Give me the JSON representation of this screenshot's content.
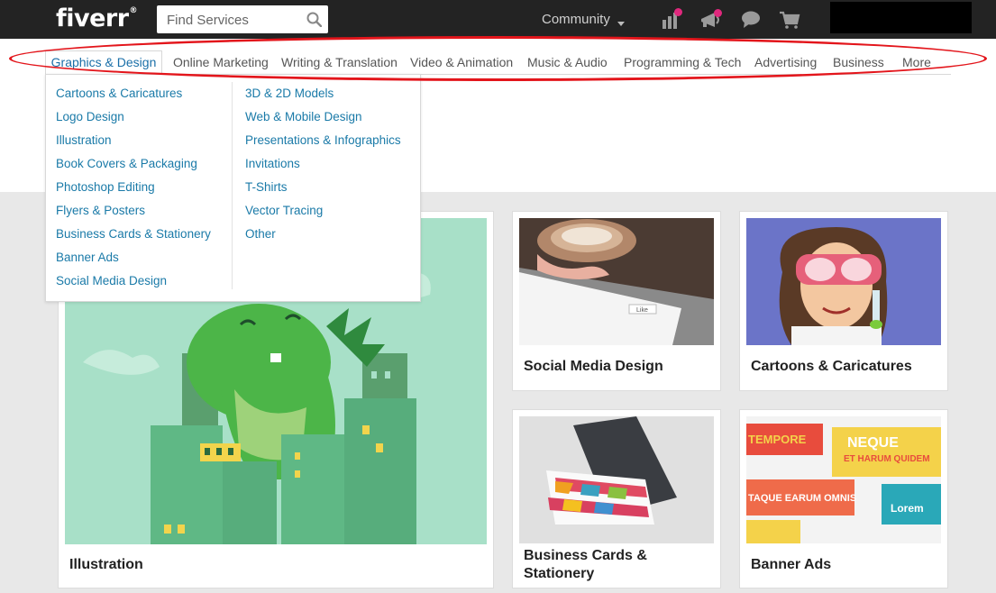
{
  "header": {
    "logo": "fiverr",
    "logo_mark": "®",
    "search_placeholder": "Find Services",
    "community_label": "Community",
    "icons": [
      "analytics-icon",
      "notifications-megaphone-icon",
      "messages-icon",
      "cart-icon"
    ],
    "notification_dot_color": "#e0287d",
    "bar_color": "#232323"
  },
  "nav": {
    "categories": [
      "Graphics & Design",
      "Online Marketing",
      "Writing & Translation",
      "Video & Animation",
      "Music & Audio",
      "Programming & Tech",
      "Advertising",
      "Business",
      "More"
    ],
    "active_color": "#1a6fa8"
  },
  "dropdown": {
    "col1": [
      "Cartoons & Caricatures",
      "Logo Design",
      "Illustration",
      "Book Covers & Packaging",
      "Photoshop Editing",
      "Flyers & Posters",
      "Business Cards & Stationery",
      "Banner Ads",
      "Social Media Design"
    ],
    "col2": [
      "3D & 2D Models",
      "Web & Mobile Design",
      "Presentations & Infographics",
      "Invitations",
      "T-Shirts",
      "Vector Tracing",
      "Other"
    ],
    "link_color": "#1a7aa8"
  },
  "cards": {
    "illustration": "Illustration",
    "social_media": "Social Media Design",
    "cartoons": "Cartoons & Caricatures",
    "business_cards": "Business Cards & Stationery",
    "banner_ads": "Banner Ads",
    "screenshot_like": "Like",
    "banner_words": [
      "NEQUE",
      "ET HARUM QUIDEM",
      "TEMPORE",
      "TAQUE EARUM OMNIS",
      "Lorem"
    ]
  },
  "highlight_color": "#e3151b"
}
